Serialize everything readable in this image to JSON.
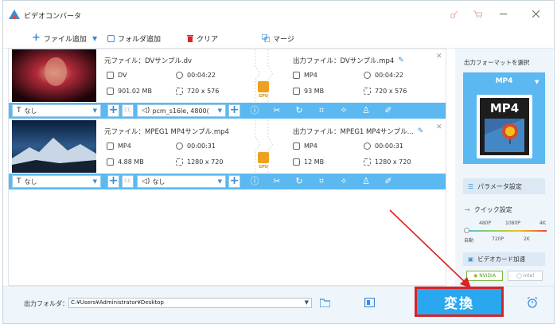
{
  "app": {
    "title": "ビデオコンバータ"
  },
  "colors": {
    "accent": "#5bb8f0",
    "convert": "#29a8f0",
    "highlight": "#d8232a",
    "gpu": "#f0a020"
  },
  "toolbar": {
    "add_file": "ファイル追加",
    "add_folder": "フォルダ追加",
    "clear": "クリア",
    "merge": "マージ"
  },
  "files": [
    {
      "src_name": "元ファイル：DVサンプル.dv",
      "src_format": "DV",
      "src_duration": "00:04:22",
      "src_size": "901.02 MB",
      "src_resolution": "720 x 576",
      "out_name": "出力ファイル：DVサンプル.mp4",
      "out_format": "MP4",
      "out_duration": "00:04:22",
      "out_size": "93 MB",
      "out_resolution": "720 x 576",
      "subtitle": "なし",
      "audio": "pcm_s16le, 4800(",
      "gpu": "GPU"
    },
    {
      "src_name": "元ファイル：MPEG1 MP4サンプル.mp4",
      "src_format": "MP4",
      "src_duration": "00:00:31",
      "src_size": "4.88 MB",
      "src_resolution": "1280 x 720",
      "out_name": "出力ファイル：MPEG1 MP4サンプル...",
      "out_format": "MP4",
      "out_duration": "00:00:31",
      "out_size": "12 MB",
      "out_resolution": "1280 x 720",
      "subtitle": "なし",
      "audio": "なし",
      "gpu": "GPU"
    }
  ],
  "right_panel": {
    "title": "出力フォーマットを選択",
    "format": "MP4",
    "format_icon_text": "MP4",
    "param_settings": "パラメータ設定",
    "quick_settings": "クイック設定",
    "quality_top": [
      "480P",
      "1080P",
      "4K"
    ],
    "quality_bottom": [
      "自動",
      "720P",
      "2K"
    ],
    "hw_accel": "ビデオカード加速",
    "nvidia": "NVIDIA",
    "intel": "Intel"
  },
  "bottom": {
    "folder_label": "出力フォルダ：",
    "folder_path": "C:¥Users¥Administrator¥Desktop",
    "convert_label": "変換"
  }
}
